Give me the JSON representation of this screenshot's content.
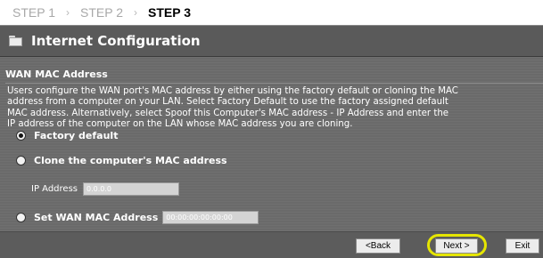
{
  "steps": {
    "step1": "STEP 1",
    "step2": "STEP 2",
    "step3": "STEP 3",
    "separator": "›"
  },
  "header": {
    "title": "Internet Configuration",
    "icon": "folder-icon"
  },
  "section": {
    "title": "WAN MAC Address",
    "description_lines": [
      "Users configure the WAN port's MAC address by either using the factory default or cloning the MAC",
      "address from a computer on your LAN. Select Factory Default to use the factory assigned default",
      "MAC address. Alternatively, select Spoof this Computer's MAC address - IP Address and enter the",
      "IP address of the computer on the LAN whose MAC address you are cloning."
    ]
  },
  "options": {
    "factory_default": "Factory default",
    "clone": "Clone the computer's MAC address",
    "ip_label": "IP Address",
    "ip_value": "0.0.0.0",
    "set_wan": "Set WAN MAC Address",
    "mac_value": "00:00:00:00:00:00",
    "selected": "factory_default"
  },
  "buttons": {
    "back": "<Back",
    "next": "Next >",
    "exit": "Exit"
  },
  "colors": {
    "panel_bg": "#6a6a6a",
    "title_bg": "#5a5a5a",
    "highlight": "#e6e600"
  }
}
